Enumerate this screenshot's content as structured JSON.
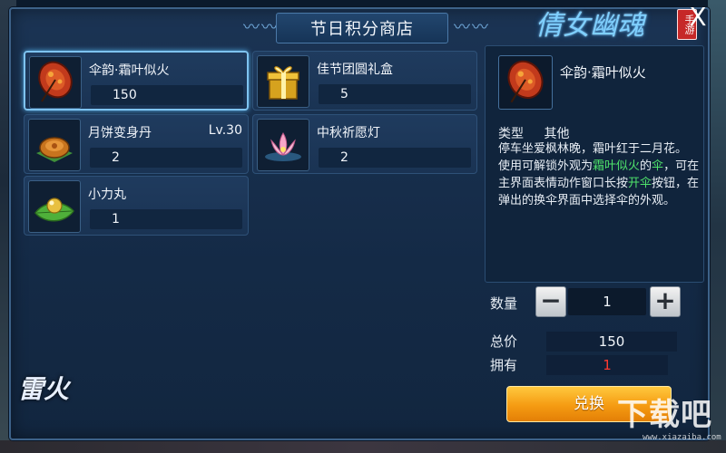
{
  "window": {
    "title": "节日积分商店",
    "logo_text": "倩女幽魂",
    "logo_badge": "手游",
    "close_label": "X"
  },
  "items": [
    {
      "name": "伞韵·霜叶似火",
      "level": "",
      "price": "150",
      "icon": "red-leaf-umbrella-icon",
      "selected": true
    },
    {
      "name": "佳节团圆礼盒",
      "level": "",
      "price": "5",
      "icon": "gold-gift-box-icon",
      "selected": false
    },
    {
      "name": "月饼变身丹",
      "level": "Lv.30",
      "price": "2",
      "icon": "mooncake-icon",
      "selected": false
    },
    {
      "name": "中秋祈愿灯",
      "level": "",
      "price": "2",
      "icon": "lotus-lantern-icon",
      "selected": false
    },
    {
      "name": "小力丸",
      "level": "",
      "price": "1",
      "icon": "pill-on-leaf-icon",
      "selected": false
    }
  ],
  "detail": {
    "name": "伞韵·霜叶似火",
    "type_label": "类型",
    "type_value": "其他",
    "desc_line1": "停车坐爱枫林晚，霜叶红于二月花。",
    "desc_part1": "使用可解锁外观为",
    "desc_hl1": "霜叶似火",
    "desc_part2": "的",
    "desc_hl2": "伞",
    "desc_part3": "，可在主界面表情动作窗口长按",
    "desc_hl3": "开伞",
    "desc_part4": "按钮，在弹出的换伞界面中选择伞的外观。"
  },
  "purchase": {
    "qty_label": "数量",
    "qty_value": "1",
    "minus_label": "−",
    "plus_label": "+",
    "total_label": "总价",
    "total_value": "150",
    "own_label": "拥有",
    "own_value": "1",
    "exchange_label": "兑换"
  },
  "watermarks": {
    "left_mark": "雷火",
    "right_mark": "下载吧",
    "right_sub": "www.xiazaiba.com"
  },
  "colors": {
    "window_bg": "#1b3454",
    "selected_border": "#7ec3f0",
    "highlight_green": "#4fe36b",
    "own_value_red": "#ff3b30",
    "exchange_orange": "#f59b12"
  }
}
